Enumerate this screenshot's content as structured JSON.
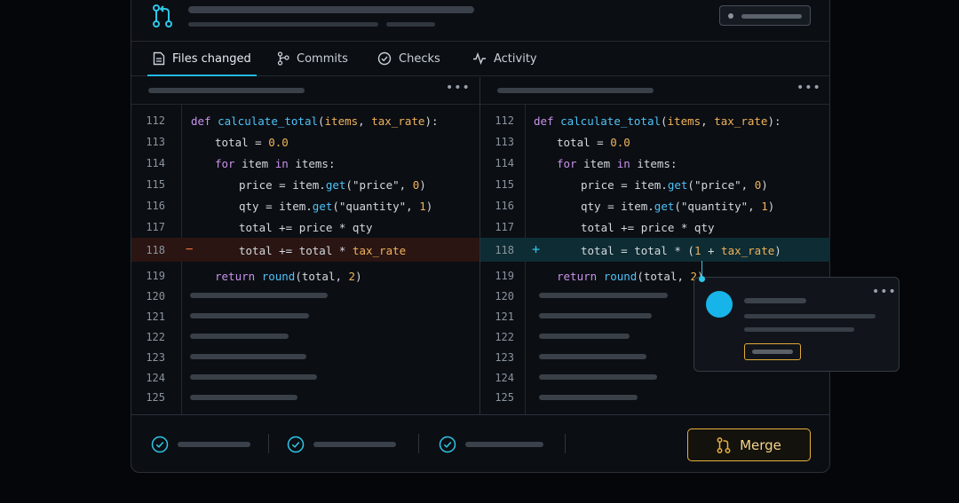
{
  "tabs": [
    {
      "label": "Files changed",
      "icon": "file-icon",
      "active": true
    },
    {
      "label": "Commits",
      "icon": "commit-icon"
    },
    {
      "label": "Checks",
      "icon": "check-circle-icon"
    },
    {
      "label": "Activity",
      "icon": "activity-icon"
    }
  ],
  "diff": {
    "left": {
      "lines": {
        "112": "112",
        "113": "113",
        "114": "114",
        "115": "115",
        "116": "116",
        "117": "117",
        "118": "118",
        "119": "119",
        "120": "120",
        "121": "121",
        "122": "122",
        "123": "123",
        "124": "124",
        "125": "125"
      },
      "removed_marker": "−"
    },
    "right": {
      "added_marker": "+"
    }
  },
  "code": {
    "l112_kw": "def ",
    "l112_fn": "calculate_total",
    "l112_p1": "(",
    "l112_a1": "items",
    "l112_c": ", ",
    "l112_a2": "tax_rate",
    "l112_p2": "):",
    "l113_a": "total = ",
    "l113_n": "0.0",
    "l114_kw1": "for ",
    "l114_a": "item ",
    "l114_kw2": "in ",
    "l114_b": "items:",
    "l115_a": "price = item.",
    "l115_fn": "get",
    "l115_b": "(\"price\", ",
    "l115_n": "0",
    "l115_c": ")",
    "l116_a": "qty = item.",
    "l116_fn": "get",
    "l116_b": "(\"quantity\", ",
    "l116_n": "1",
    "l116_c": ")",
    "l117": "total += price * qty",
    "l118_old_a": "total += total * ",
    "l118_old_b": "tax_rate",
    "l118_new_a": "total = total * (",
    "l118_new_n": "1",
    "l118_new_b": " + ",
    "l118_new_c": "tax_rate",
    "l118_new_d": ")",
    "l119_kw": "return ",
    "l119_fn": "round",
    "l119_a": "(total, ",
    "l119_n": "2",
    "l119_b": ")"
  },
  "footer": {
    "merge_label": "Merge",
    "merge_icon": "merge-icon"
  },
  "colors": {
    "accent": "#22b8e6",
    "merge_border": "#e9b23c",
    "removed_bg": "#2a1512",
    "added_bg": "#0e2c33"
  }
}
